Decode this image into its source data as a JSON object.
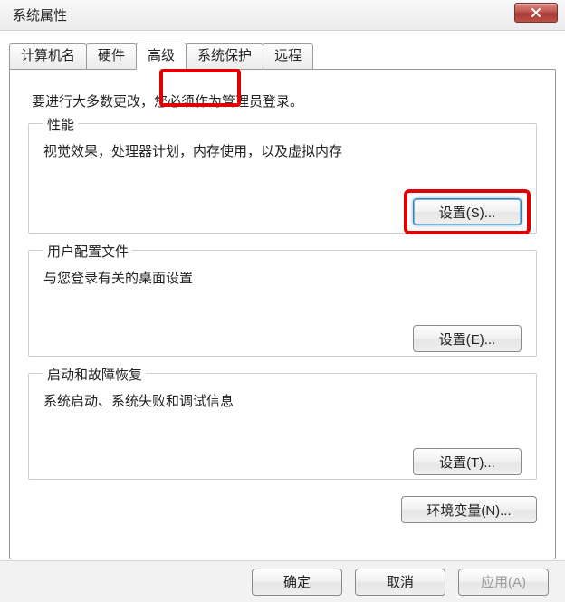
{
  "window": {
    "title": "系统属性"
  },
  "tabs": {
    "computer_name": "计算机名",
    "hardware": "硬件",
    "advanced": "高级",
    "system_protection": "系统保护",
    "remote": "远程"
  },
  "intro": "要进行大多数更改，您必须作为管理员登录。",
  "group_performance": {
    "legend": "性能",
    "desc": "视觉效果，处理器计划，内存使用，以及虚拟内存",
    "button": "设置(S)..."
  },
  "group_profiles": {
    "legend": "用户配置文件",
    "desc": "与您登录有关的桌面设置",
    "button": "设置(E)..."
  },
  "group_startup": {
    "legend": "启动和故障恢复",
    "desc": "系统启动、系统失败和调试信息",
    "button": "设置(T)..."
  },
  "env_button": "环境变量(N)...",
  "footer": {
    "ok": "确定",
    "cancel": "取消",
    "apply": "应用(A)"
  },
  "highlight": {
    "color": "#e10000"
  }
}
